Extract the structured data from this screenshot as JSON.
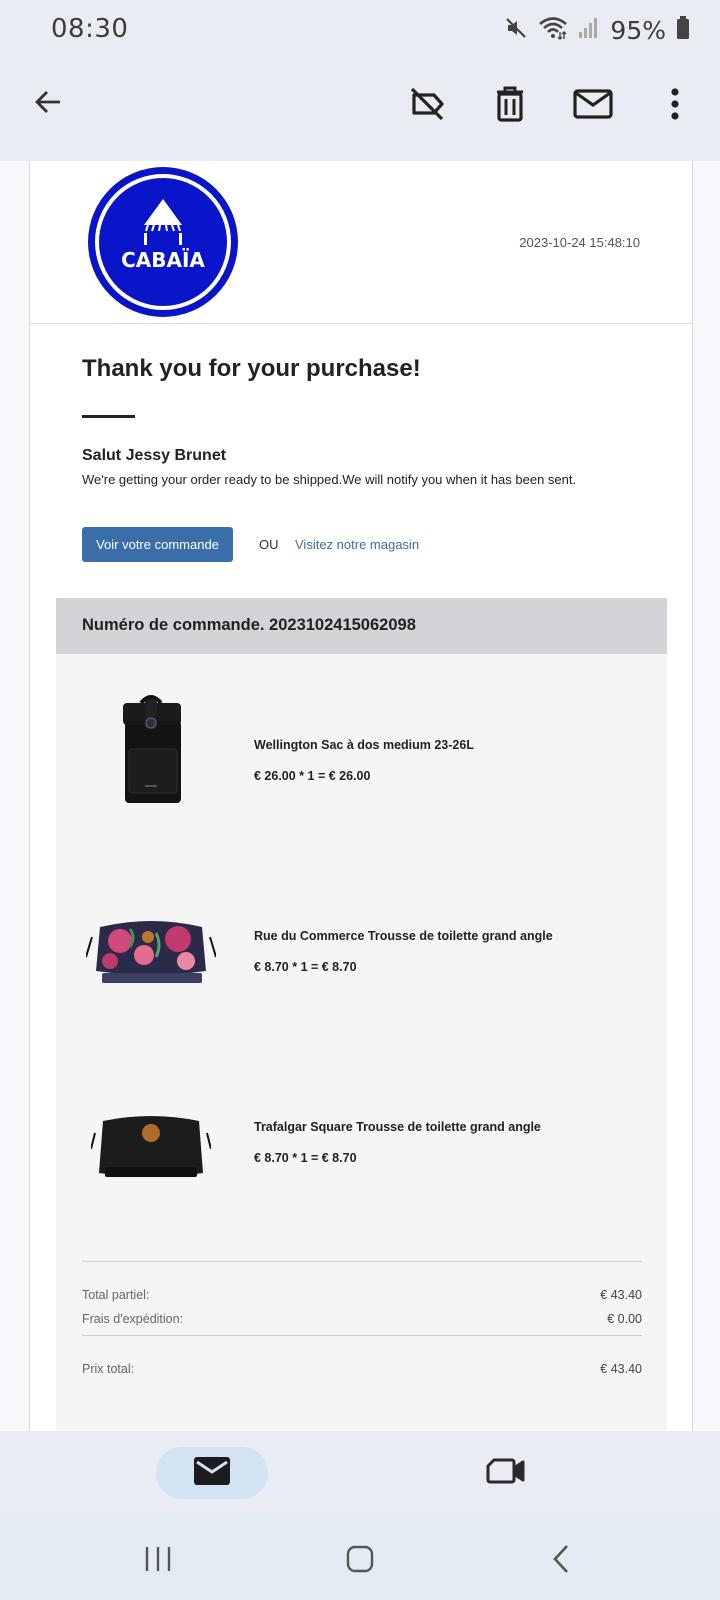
{
  "status_bar": {
    "time": "08:30",
    "battery": "95%",
    "icons": [
      "mute-icon",
      "wifi-icon",
      "signal-icon",
      "battery-icon"
    ]
  },
  "toolbar": {
    "icons": [
      "back-arrow-icon",
      "label-off-icon",
      "delete-icon",
      "mark-unread-icon",
      "more-vert-icon"
    ]
  },
  "email": {
    "brand": "CABAÏA",
    "brand_color": "#0a14c8",
    "date": "2023-10-24 15:48:10",
    "title": "Thank you for your purchase!",
    "greeting": "Salut Jessy Brunet",
    "message": "We're getting your order ready to be shipped.We will notify you when it has been sent.",
    "view_order_label": "Voir votre commande",
    "or_label": "OU",
    "store_link_label": "Visitez notre magasin",
    "order_number_label": "Numéro de commande. 2023102415062098",
    "items": [
      {
        "name": "Wellington Sac à dos medium 23-26L",
        "price_line": "€ 26.00 * 1 = € 26.00",
        "image": "black-backpack"
      },
      {
        "name": "Rue du Commerce Trousse de toilette grand angle",
        "price_line": "€ 8.70 * 1 = € 8.70",
        "image": "floral-toiletry-bag"
      },
      {
        "name": "Trafalgar Square Trousse de toilette grand angle",
        "price_line": "€ 8.70 * 1 = € 8.70",
        "image": "black-toiletry-bag"
      }
    ],
    "summary": {
      "subtotal_label": "Total partiel:",
      "subtotal_value": "€ 43.40",
      "shipping_label": "Frais d'expédition:",
      "shipping_value": "€ 0.00",
      "total_label": "Prix total:",
      "total_value": "€ 43.40"
    }
  },
  "bottom_nav": {
    "items": [
      "mail-icon",
      "video-icon"
    ],
    "active": "mail-icon"
  },
  "system_nav": {
    "items": [
      "recents-icon",
      "home-icon",
      "back-icon"
    ]
  },
  "colors": {
    "button_blue": "#3a6ea8",
    "header_grey": "#d3d4d8",
    "body_grey": "#f5f5f5",
    "nav_pill": "#d3e3f4"
  }
}
